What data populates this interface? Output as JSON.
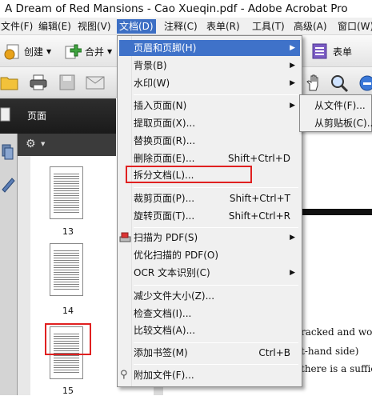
{
  "window": {
    "title": "A Dream of Red Mansions - Cao Xueqin.pdf - Adobe Acrobat Pro"
  },
  "menubar": {
    "items": [
      "文件(F)",
      "编辑(E)",
      "视图(V)",
      "文档(D)",
      "注释(C)",
      "表单(R)",
      "工具(T)",
      "高级(A)",
      "窗口(W)"
    ]
  },
  "toolbar": {
    "create_label": "创建",
    "combine_label": "合并",
    "forms_label": "表单"
  },
  "panel": {
    "title": "页面",
    "thumbnails": [
      "13",
      "14",
      "15"
    ]
  },
  "document_menu": {
    "items": [
      {
        "label": "页眉和页脚(H)",
        "shortcut": "",
        "submenu": true
      },
      {
        "label": "背景(B)",
        "shortcut": "",
        "submenu": true
      },
      {
        "label": "水印(W)",
        "shortcut": "",
        "submenu": true
      },
      {
        "label": "插入页面(N)",
        "shortcut": "",
        "submenu": true
      },
      {
        "label": "提取页面(X)...",
        "shortcut": "",
        "submenu": false
      },
      {
        "label": "替换页面(R)...",
        "shortcut": "",
        "submenu": false
      },
      {
        "label": "删除页面(E)...",
        "shortcut": "Shift+Ctrl+D",
        "submenu": false
      },
      {
        "label": "拆分文档(L)...",
        "shortcut": "",
        "submenu": false
      },
      {
        "label": "裁剪页面(P)...",
        "shortcut": "Shift+Ctrl+T",
        "submenu": false
      },
      {
        "label": "旋转页面(T)...",
        "shortcut": "Shift+Ctrl+R",
        "submenu": false
      },
      {
        "label": "扫描为 PDF(S)",
        "shortcut": "",
        "submenu": true
      },
      {
        "label": "优化扫描的 PDF(O)",
        "shortcut": "",
        "submenu": false
      },
      {
        "label": "OCR 文本识别(C)",
        "shortcut": "",
        "submenu": true
      },
      {
        "label": "减少文件大小(Z)...",
        "shortcut": "",
        "submenu": false
      },
      {
        "label": "检查文档(I)...",
        "shortcut": "",
        "submenu": false
      },
      {
        "label": "比较文档(A)...",
        "shortcut": "",
        "submenu": false
      },
      {
        "label": "添加书签(M)",
        "shortcut": "Ctrl+B",
        "submenu": false
      },
      {
        "label": "附加文件(F)...",
        "shortcut": "",
        "submenu": false
      }
    ]
  },
  "insert_submenu": {
    "items": [
      "从文件(F)...",
      "从剪贴板(C)..."
    ]
  },
  "document_text": {
    "line1": "racked and worn",
    "line2": "t-hand side)",
    "line3": "there is a suffici"
  },
  "colors": {
    "highlight": "#3f72c9",
    "annotation_red": "#e02020",
    "menubar_active": "#3d6fc4"
  }
}
